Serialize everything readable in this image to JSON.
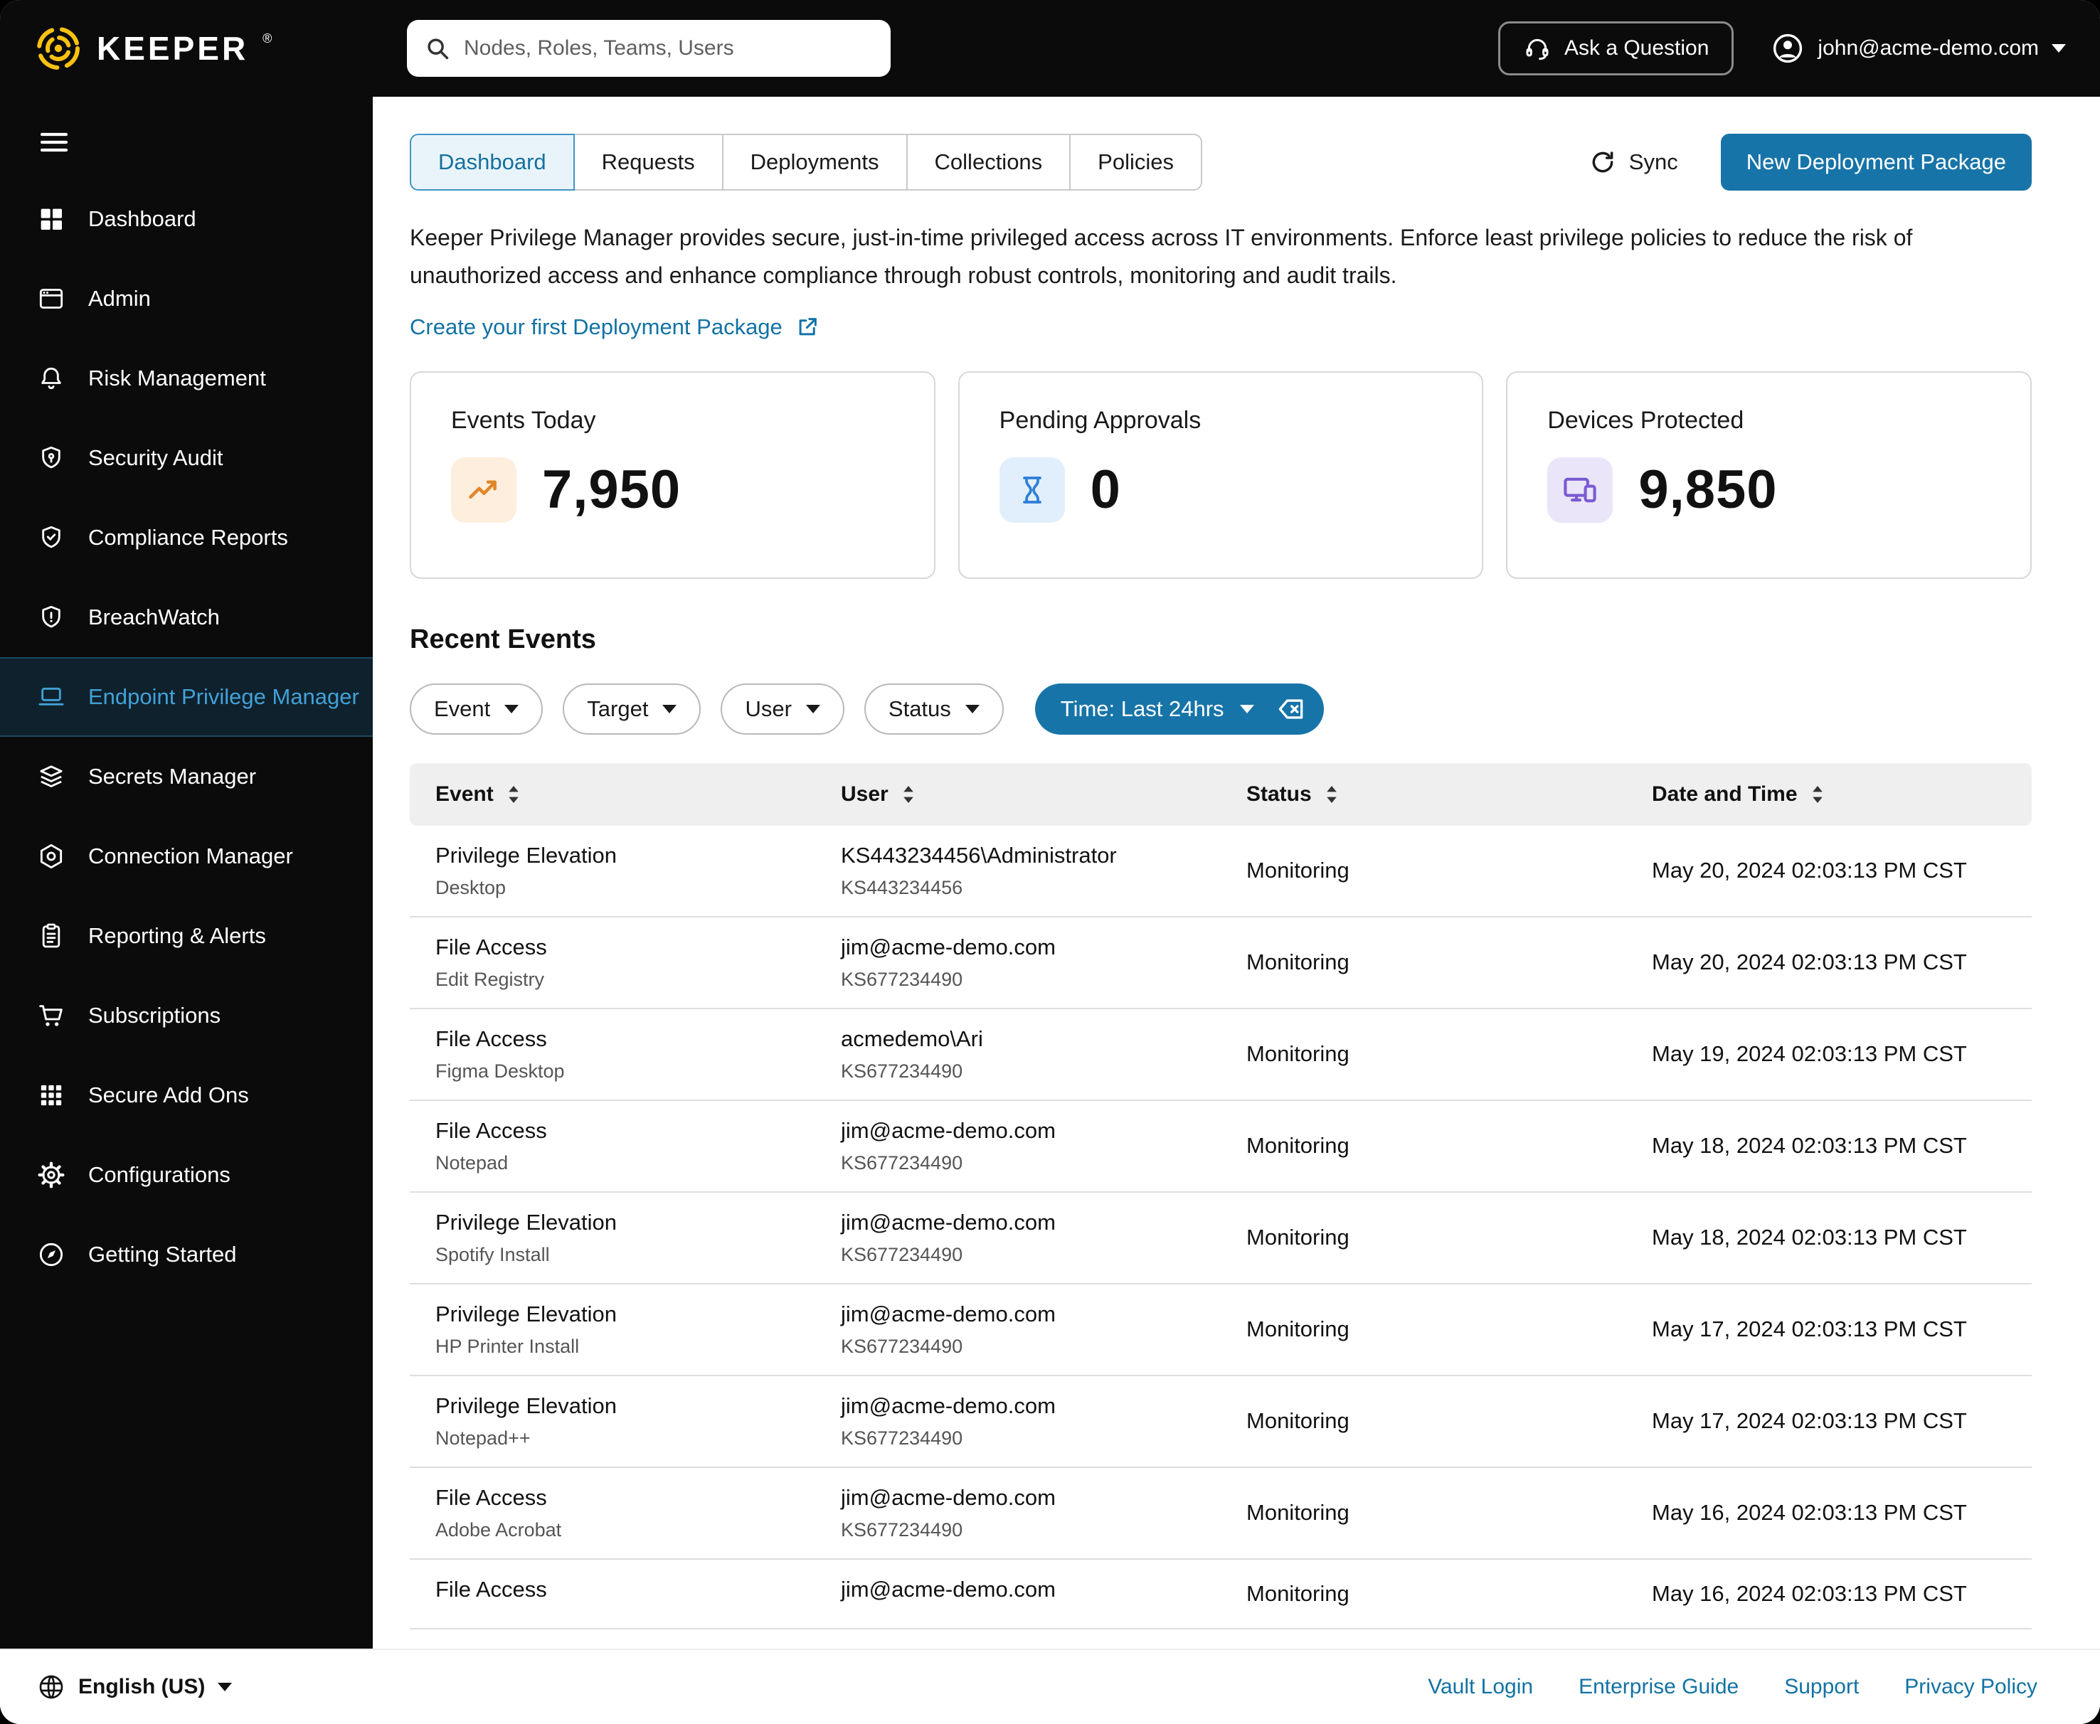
{
  "topbar": {
    "brand": "KEEPER",
    "brand_mark": "®",
    "search_placeholder": "Nodes, Roles, Teams, Users",
    "ask_button": "Ask a Question",
    "account_email": "john@acme-demo.com"
  },
  "sidebar": {
    "items": [
      {
        "label": "Dashboard",
        "icon": "dashboard-icon"
      },
      {
        "label": "Admin",
        "icon": "window-icon"
      },
      {
        "label": "Risk Management",
        "icon": "bell-icon"
      },
      {
        "label": "Security Audit",
        "icon": "shield-icon"
      },
      {
        "label": "Compliance Reports",
        "icon": "shield-check-icon"
      },
      {
        "label": "BreachWatch",
        "icon": "shield-alert-icon"
      },
      {
        "label": "Endpoint Privilege Manager",
        "icon": "laptop-icon",
        "active": true
      },
      {
        "label": "Secrets Manager",
        "icon": "layers-icon"
      },
      {
        "label": "Connection Manager",
        "icon": "hexagon-icon"
      },
      {
        "label": "Reporting & Alerts",
        "icon": "clipboard-icon"
      },
      {
        "label": "Subscriptions",
        "icon": "cart-icon"
      },
      {
        "label": "Secure Add Ons",
        "icon": "apps-grid-icon"
      },
      {
        "label": "Configurations",
        "icon": "gear-icon"
      },
      {
        "label": "Getting Started",
        "icon": "compass-icon"
      }
    ]
  },
  "page": {
    "tabs": [
      "Dashboard",
      "Requests",
      "Deployments",
      "Collections",
      "Policies"
    ],
    "sync_label": "Sync",
    "new_package_label": "New Deployment Package",
    "intro": "Keeper Privilege Manager provides secure, just-in-time privileged access across IT environments. Enforce least privilege policies to reduce the risk of unauthorized access and enhance compliance through robust controls, monitoring and audit trails.",
    "create_link": "Create your first Deployment Package"
  },
  "stats": [
    {
      "label": "Events Today",
      "value": "7,950",
      "icon": "trend-up-icon",
      "icon_color": "#e0862a",
      "icon_bg": "#fdeedd"
    },
    {
      "label": "Pending Approvals",
      "value": "0",
      "icon": "hourglass-icon",
      "icon_color": "#2f7fd6",
      "icon_bg": "#e1effc"
    },
    {
      "label": "Devices Protected",
      "value": "9,850",
      "icon": "devices-icon",
      "icon_color": "#7a5ad2",
      "icon_bg": "#ebe5f9"
    }
  ],
  "recent_events": {
    "title": "Recent Events",
    "filters": [
      "Event",
      "Target",
      "User",
      "Status"
    ],
    "time_filter": "Time: Last 24hrs",
    "columns": [
      "Event",
      "User",
      "Status",
      "Date and Time"
    ],
    "rows": [
      {
        "event": "Privilege Elevation",
        "event_sub": "Desktop",
        "user": "KS443234456\\Administrator",
        "user_sub": "KS443234456",
        "status": "Monitoring",
        "date": "May 20, 2024 02:03:13 PM CST"
      },
      {
        "event": "File Access",
        "event_sub": "Edit Registry",
        "user": "jim@acme-demo.com",
        "user_sub": "KS677234490",
        "status": "Monitoring",
        "date": "May 20, 2024 02:03:13 PM CST"
      },
      {
        "event": "File Access",
        "event_sub": "Figma Desktop",
        "user": "acmedemo\\Ari",
        "user_sub": "KS677234490",
        "status": "Monitoring",
        "date": "May 19, 2024 02:03:13 PM CST"
      },
      {
        "event": "File Access",
        "event_sub": "Notepad",
        "user": "jim@acme-demo.com",
        "user_sub": "KS677234490",
        "status": "Monitoring",
        "date": "May 18, 2024 02:03:13 PM CST"
      },
      {
        "event": "Privilege Elevation",
        "event_sub": "Spotify Install",
        "user": "jim@acme-demo.com",
        "user_sub": "KS677234490",
        "status": "Monitoring",
        "date": "May 18, 2024 02:03:13 PM CST"
      },
      {
        "event": "Privilege Elevation",
        "event_sub": "HP Printer Install",
        "user": "jim@acme-demo.com",
        "user_sub": "KS677234490",
        "status": "Monitoring",
        "date": "May 17, 2024 02:03:13 PM CST"
      },
      {
        "event": "Privilege Elevation",
        "event_sub": "Notepad++",
        "user": "jim@acme-demo.com",
        "user_sub": "KS677234490",
        "status": "Monitoring",
        "date": "May 17, 2024 02:03:13 PM CST"
      },
      {
        "event": "File Access",
        "event_sub": "Adobe Acrobat",
        "user": "jim@acme-demo.com",
        "user_sub": "KS677234490",
        "status": "Monitoring",
        "date": "May 16, 2024 02:03:13 PM CST"
      },
      {
        "event": "File Access",
        "event_sub": "",
        "user": "jim@acme-demo.com",
        "user_sub": "",
        "status": "Monitoring",
        "date": "May 16, 2024 02:03:13 PM CST"
      }
    ]
  },
  "footer": {
    "language": "English (US)",
    "links": [
      "Vault Login",
      "Enterprise Guide",
      "Support",
      "Privacy Policy"
    ]
  },
  "colors": {
    "accent_blue": "#1774a8",
    "link_blue": "#1272a4",
    "sidebar_active_blue": "#42a1d8",
    "brand_yellow": "#f9c112",
    "stat_orange": "#e0862a",
    "stat_blue": "#2f7fd6",
    "stat_purple": "#7a5ad2",
    "topbar_black": "#0b0b0b"
  }
}
